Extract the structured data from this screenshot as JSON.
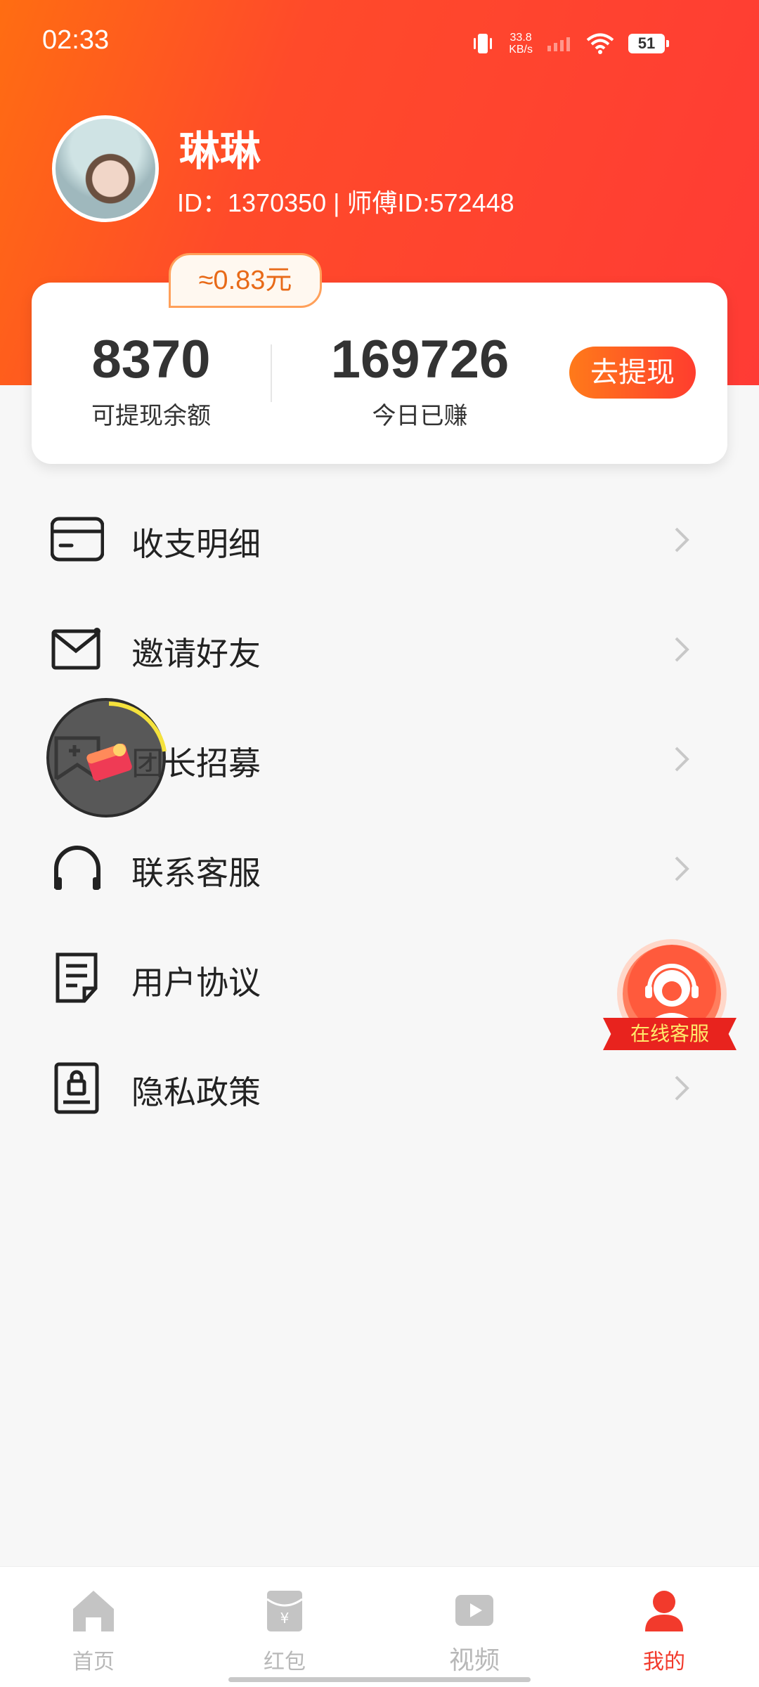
{
  "status_bar": {
    "time": "02:33",
    "net_speed_value": "33.8",
    "net_speed_unit": "KB/s",
    "battery": "51"
  },
  "profile": {
    "name": "琳琳",
    "ids_line": "ID：1370350  |  师傅ID:572448"
  },
  "balance": {
    "approx_value": "≈0.83元",
    "withdrawable_amount": "8370",
    "withdrawable_label": "可提现余额",
    "today_earned_amount": "169726",
    "today_earned_label": "今日已赚",
    "withdraw_button": "去提现"
  },
  "menu": [
    {
      "label": "收支明细",
      "icon": "wallet-card-icon"
    },
    {
      "label": "邀请好友",
      "icon": "envelope-icon"
    },
    {
      "label": "团长招募",
      "icon": "recruit-flag-icon"
    },
    {
      "label": "联系客服",
      "icon": "headphones-icon"
    },
    {
      "label": "用户协议",
      "icon": "document-icon"
    },
    {
      "label": "隐私政策",
      "icon": "lock-document-icon"
    }
  ],
  "floating_cs": {
    "label": "在线客服"
  },
  "bottom_nav": [
    {
      "label": "首页",
      "icon": "home-icon",
      "active": false
    },
    {
      "label": "红包",
      "icon": "red-packet-icon",
      "active": false
    },
    {
      "label": "视频",
      "icon": "video-play-icon",
      "active": false
    },
    {
      "label": "我的",
      "icon": "user-icon",
      "active": true
    }
  ],
  "colors": {
    "brand_red": "#ff3b35",
    "brand_orange": "#ff6d12",
    "active_tab": "#f23a2c"
  }
}
